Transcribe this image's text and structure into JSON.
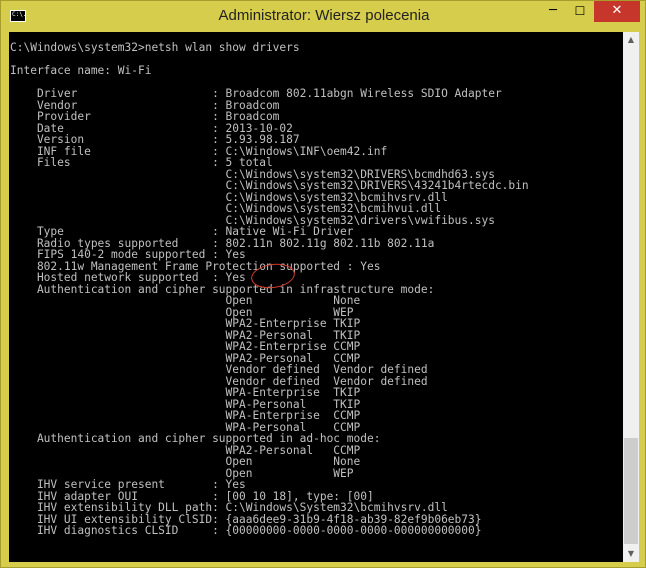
{
  "window": {
    "title": "Administrator: Wiersz polecenia",
    "icon_text": "C:\\.",
    "minimize_icon": "─",
    "maximize_icon": "☐",
    "close_icon": "✕"
  },
  "console": {
    "lines": [
      "C:\\Windows\\system32>netsh wlan show drivers",
      "",
      "Interface name: Wi-Fi",
      "",
      "    Driver                    : Broadcom 802.11abgn Wireless SDIO Adapter",
      "    Vendor                    : Broadcom",
      "    Provider                  : Broadcom",
      "    Date                      : 2013-10-02",
      "    Version                   : 5.93.98.187",
      "    INF file                  : C:\\Windows\\INF\\oem42.inf",
      "    Files                     : 5 total",
      "                                C:\\Windows\\system32\\DRIVERS\\bcmdhd63.sys",
      "                                C:\\Windows\\system32\\DRIVERS\\43241b4rtecdc.bin",
      "                                C:\\Windows\\system32\\bcmihvsrv.dll",
      "                                C:\\Windows\\system32\\bcmihvui.dll",
      "                                C:\\Windows\\system32\\drivers\\vwifibus.sys",
      "    Type                      : Native Wi-Fi Driver",
      "    Radio types supported     : 802.11n 802.11g 802.11b 802.11a",
      "    FIPS 140-2 mode supported : Yes",
      "    802.11w Management Frame Protection supported : Yes",
      "    Hosted network supported  : Yes",
      "    Authentication and cipher supported in infrastructure mode:",
      "                                Open            None",
      "                                Open            WEP",
      "                                WPA2-Enterprise TKIP",
      "                                WPA2-Personal   TKIP",
      "                                WPA2-Enterprise CCMP",
      "                                WPA2-Personal   CCMP",
      "                                Vendor defined  Vendor defined",
      "                                Vendor defined  Vendor defined",
      "                                WPA-Enterprise  TKIP",
      "                                WPA-Personal    TKIP",
      "                                WPA-Enterprise  CCMP",
      "                                WPA-Personal    CCMP",
      "    Authentication and cipher supported in ad-hoc mode:",
      "                                WPA2-Personal   CCMP",
      "                                Open            None",
      "                                Open            WEP",
      "    IHV service present       : Yes",
      "    IHV adapter OUI           : [00 10 18], type: [00]",
      "    IHV extensibility DLL path: C:\\Windows\\System32\\bcmihvsrv.dll",
      "    IHV UI extensibility ClSID: {aaa6dee9-31b9-4f18-ab39-82ef9b06eb73}",
      "    IHV diagnostics CLSID     : {00000000-0000-0000-0000-000000000000}"
    ]
  },
  "scrollbar": {
    "up_icon": "▲",
    "down_icon": "▼"
  },
  "colors": {
    "titlebar": "#d6cd4c",
    "close": "#c7362a",
    "console_bg": "#000000",
    "console_text": "#c0c0c0",
    "annotation": "#d23a2a"
  }
}
